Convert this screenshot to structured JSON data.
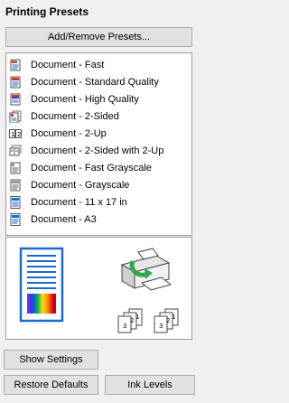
{
  "panel": {
    "title": "Printing Presets",
    "add_remove_label": "Add/Remove Presets..."
  },
  "presets": [
    {
      "label": "Document - Fast",
      "icon": "document-fast-icon"
    },
    {
      "label": "Document - Standard Quality",
      "icon": "document-standard-icon"
    },
    {
      "label": "Document - High Quality",
      "icon": "document-high-quality-icon"
    },
    {
      "label": "Document - 2-Sided",
      "icon": "document-2-sided-icon"
    },
    {
      "label": "Document - 2-Up",
      "icon": "document-2-up-icon"
    },
    {
      "label": "Document - 2-Sided with 2-Up",
      "icon": "document-2-sided-2-up-icon"
    },
    {
      "label": "Document - Fast Grayscale",
      "icon": "document-fast-grayscale-icon"
    },
    {
      "label": "Document - Grayscale",
      "icon": "document-grayscale-icon"
    },
    {
      "label": "Document - 11 x 17 in",
      "icon": "document-11x17-icon"
    },
    {
      "label": "Document - A3",
      "icon": "document-a3-icon"
    }
  ],
  "preview": {
    "collate_pages_front": [
      "1",
      "2",
      "3"
    ],
    "collate_pages_back": [
      "1",
      "2",
      "3"
    ]
  },
  "buttons": {
    "show_settings": "Show Settings",
    "restore_defaults": "Restore Defaults",
    "ink_levels": "Ink Levels"
  },
  "colors": {
    "page_blue": "#1a6ad0",
    "printer_green": "#2fa84f",
    "button_face": "#e1e1e1",
    "panel_bg": "#f0f0f0"
  }
}
